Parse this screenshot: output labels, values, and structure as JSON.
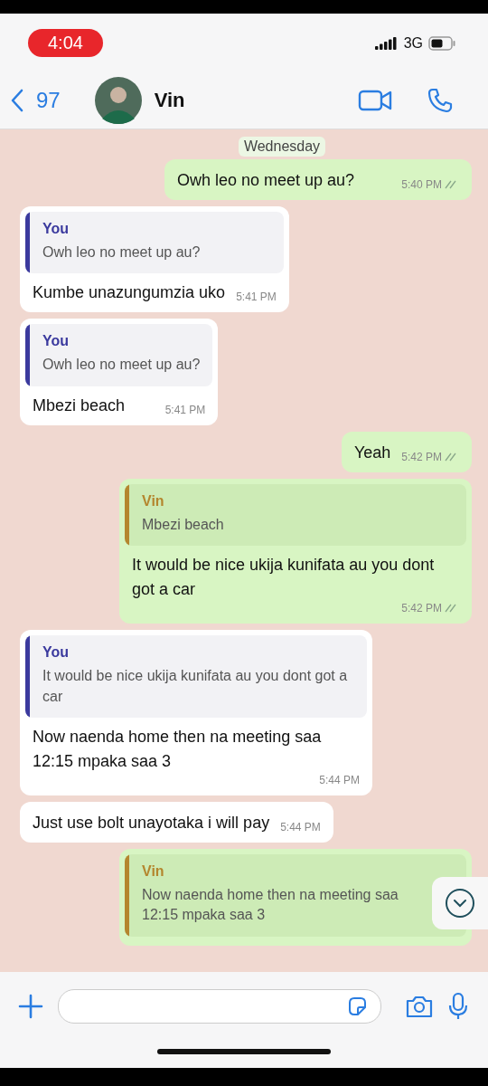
{
  "status_bar": {
    "time": "4:04",
    "network": "3G"
  },
  "header": {
    "back_count": "97",
    "contact_name": "Vin"
  },
  "date_chip": "Wednesday",
  "messages": [
    {
      "kind": "out",
      "text": "Owh leo no meet up au?",
      "time": "5:40 PM",
      "delivered": true
    },
    {
      "kind": "in",
      "quote": {
        "author": "You",
        "color": "#3b3a9e",
        "text": "Owh leo no meet up au?"
      },
      "text": "Kumbe unazungumzia uko",
      "time": "5:41 PM"
    },
    {
      "kind": "in",
      "quote": {
        "author": "You",
        "color": "#3b3a9e",
        "text": "Owh leo no meet up au?"
      },
      "text": "Mbezi beach",
      "time": "5:41 PM"
    },
    {
      "kind": "out",
      "text": "Yeah",
      "time": "5:42 PM",
      "delivered": true
    },
    {
      "kind": "out",
      "quote": {
        "author": "Vin",
        "color": "#b4862e",
        "text": "Mbezi beach"
      },
      "text": "It would be nice ukija kunifata au you dont got a car",
      "time": "5:42 PM",
      "delivered": true
    },
    {
      "kind": "in",
      "quote": {
        "author": "You",
        "color": "#3b3a9e",
        "text": "It would be nice ukija kunifata au you dont got a car"
      },
      "text": "Now naenda home then na meeting saa 12:15 mpaka saa 3",
      "time": "5:44 PM"
    },
    {
      "kind": "in",
      "text": "Just use bolt unayotaka i will pay",
      "time": "5:44 PM"
    },
    {
      "kind": "out",
      "quote": {
        "author": "Vin",
        "color": "#b4862e",
        "text": "Now naenda home then na meeting saa 12:15 mpaka saa 3"
      }
    }
  ]
}
